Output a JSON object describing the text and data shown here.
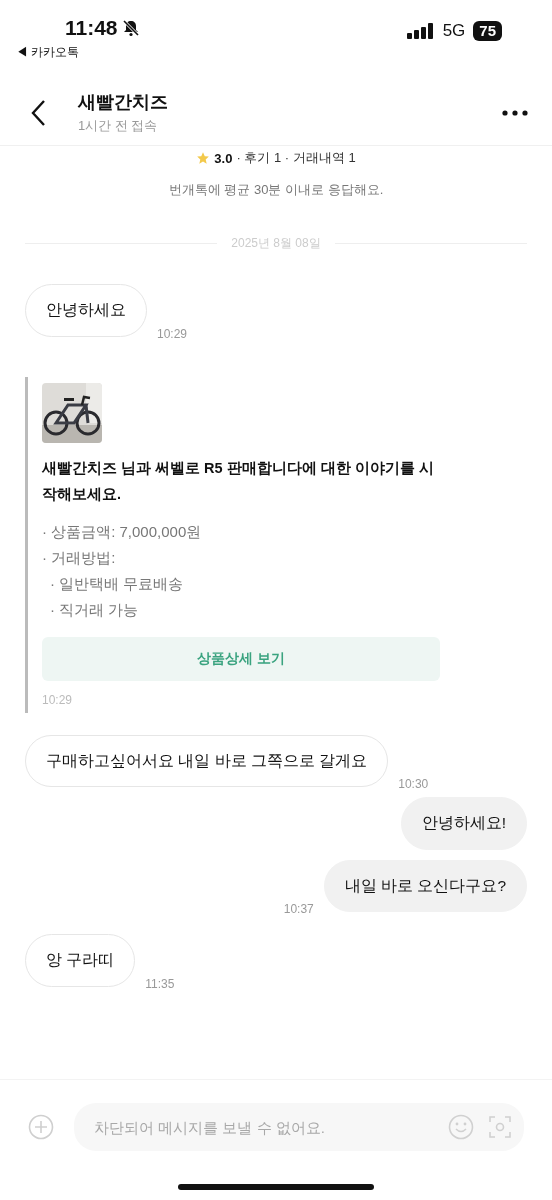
{
  "status_bar": {
    "time": "11:48",
    "back_app": "◀ 카카오톡",
    "network": "5G",
    "battery": "75",
    "silent": true
  },
  "header": {
    "title": "새빨간치즈",
    "subtitle": "1시간 전 접속"
  },
  "profile": {
    "rating": "3.0",
    "stats": "· 후기 1 · 거래내역 1",
    "response": "번개톡에 평균 30분 이내로 응답해요."
  },
  "date": "2025년 8월 08일",
  "messages": [
    {
      "kind": "incoming",
      "text": "안녕하세요",
      "time": "10:29"
    },
    {
      "kind": "product",
      "title": "새빨간치즈 님과 써벨로 R5 판매합니다에 대한 이야기를 시작해보세요.",
      "details": [
        {
          "text": "· 상품금액: 7,000,000원"
        },
        {
          "text": "· 거래방법:",
          "children": [
            {
              "text": "· 일반택배 무료배송"
            },
            {
              "text": "· 직거래 가능"
            }
          ]
        }
      ],
      "button": "상품상세 보기",
      "time": "10:29"
    },
    {
      "kind": "incoming",
      "text": "구매하고싶어서요 내일 바로 그쪽으로 갈게요",
      "time": "10:30"
    },
    {
      "kind": "outgoing",
      "text": "안녕하세요!"
    },
    {
      "kind": "outgoing",
      "text": "내일 바로 오신다구요?",
      "time": "10:37"
    },
    {
      "kind": "incoming",
      "text": "앙 구라띠",
      "time": "11:35"
    }
  ],
  "composer": {
    "placeholder": "차단되어 메시지를 보낼 수 없어요."
  }
}
